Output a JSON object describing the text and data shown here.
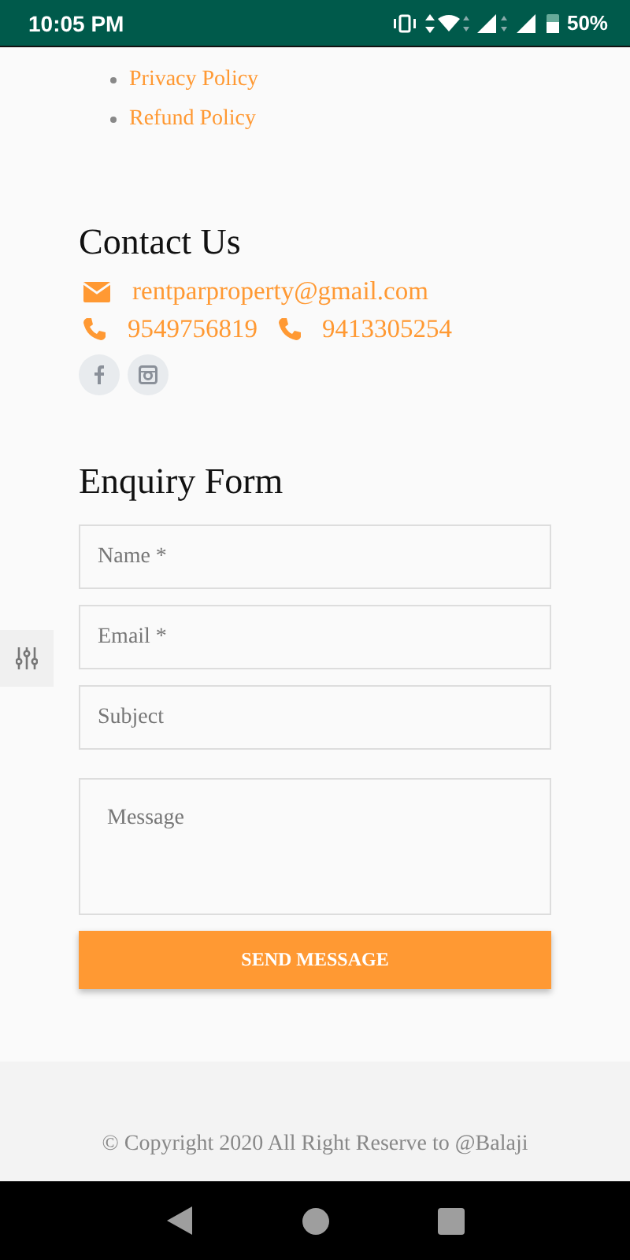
{
  "status_bar": {
    "time": "10:05 PM",
    "battery": "50%"
  },
  "policy_links": [
    "Privacy Policy",
    "Refund Policy"
  ],
  "contact": {
    "title": "Contact Us",
    "email": "rentparproperty@gmail.com",
    "phones": [
      "9549756819",
      "9413305254"
    ]
  },
  "enquiry_form": {
    "title": "Enquiry Form",
    "fields": [
      {
        "kind": "input",
        "placeholder": "Name *"
      },
      {
        "kind": "input",
        "placeholder": "Email *"
      },
      {
        "kind": "input",
        "placeholder": "Subject"
      },
      {
        "kind": "textarea",
        "placeholder": "Message"
      }
    ],
    "submit": "SEND MESSAGE"
  },
  "footer": {
    "copyright": "© Copyright 2020 All Right Reserve to @Balaji"
  }
}
